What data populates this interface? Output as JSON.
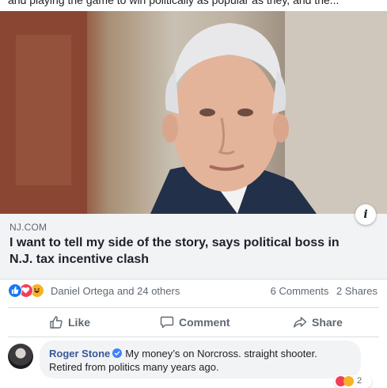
{
  "post": {
    "text": "and playing the game to win politically as popular as they, and the..."
  },
  "link": {
    "domain": "NJ.COM",
    "headline": "I want to tell my side of the story, says political boss in N.J. tax incentive clash",
    "info_icon": "info-icon"
  },
  "stats": {
    "reaction_icons": [
      "like-reaction-icon",
      "love-reaction-icon",
      "haha-reaction-icon"
    ],
    "reactors": "Daniel Ortega and 24 others",
    "comments": "6 Comments",
    "shares": "2 Shares"
  },
  "actions": {
    "like": "Like",
    "comment": "Comment",
    "share": "Share"
  },
  "comment": {
    "author": "Roger Stone",
    "text": "My money’s on Norcross. straight shooter. Retired from politics many years ago.",
    "reaction_count": "2"
  },
  "colors": {
    "facebook_blue": "#1877f2",
    "link_blue": "#385898",
    "love_red": "#f33e58",
    "haha_yellow": "#f7b125",
    "muted_text": "#606770"
  }
}
